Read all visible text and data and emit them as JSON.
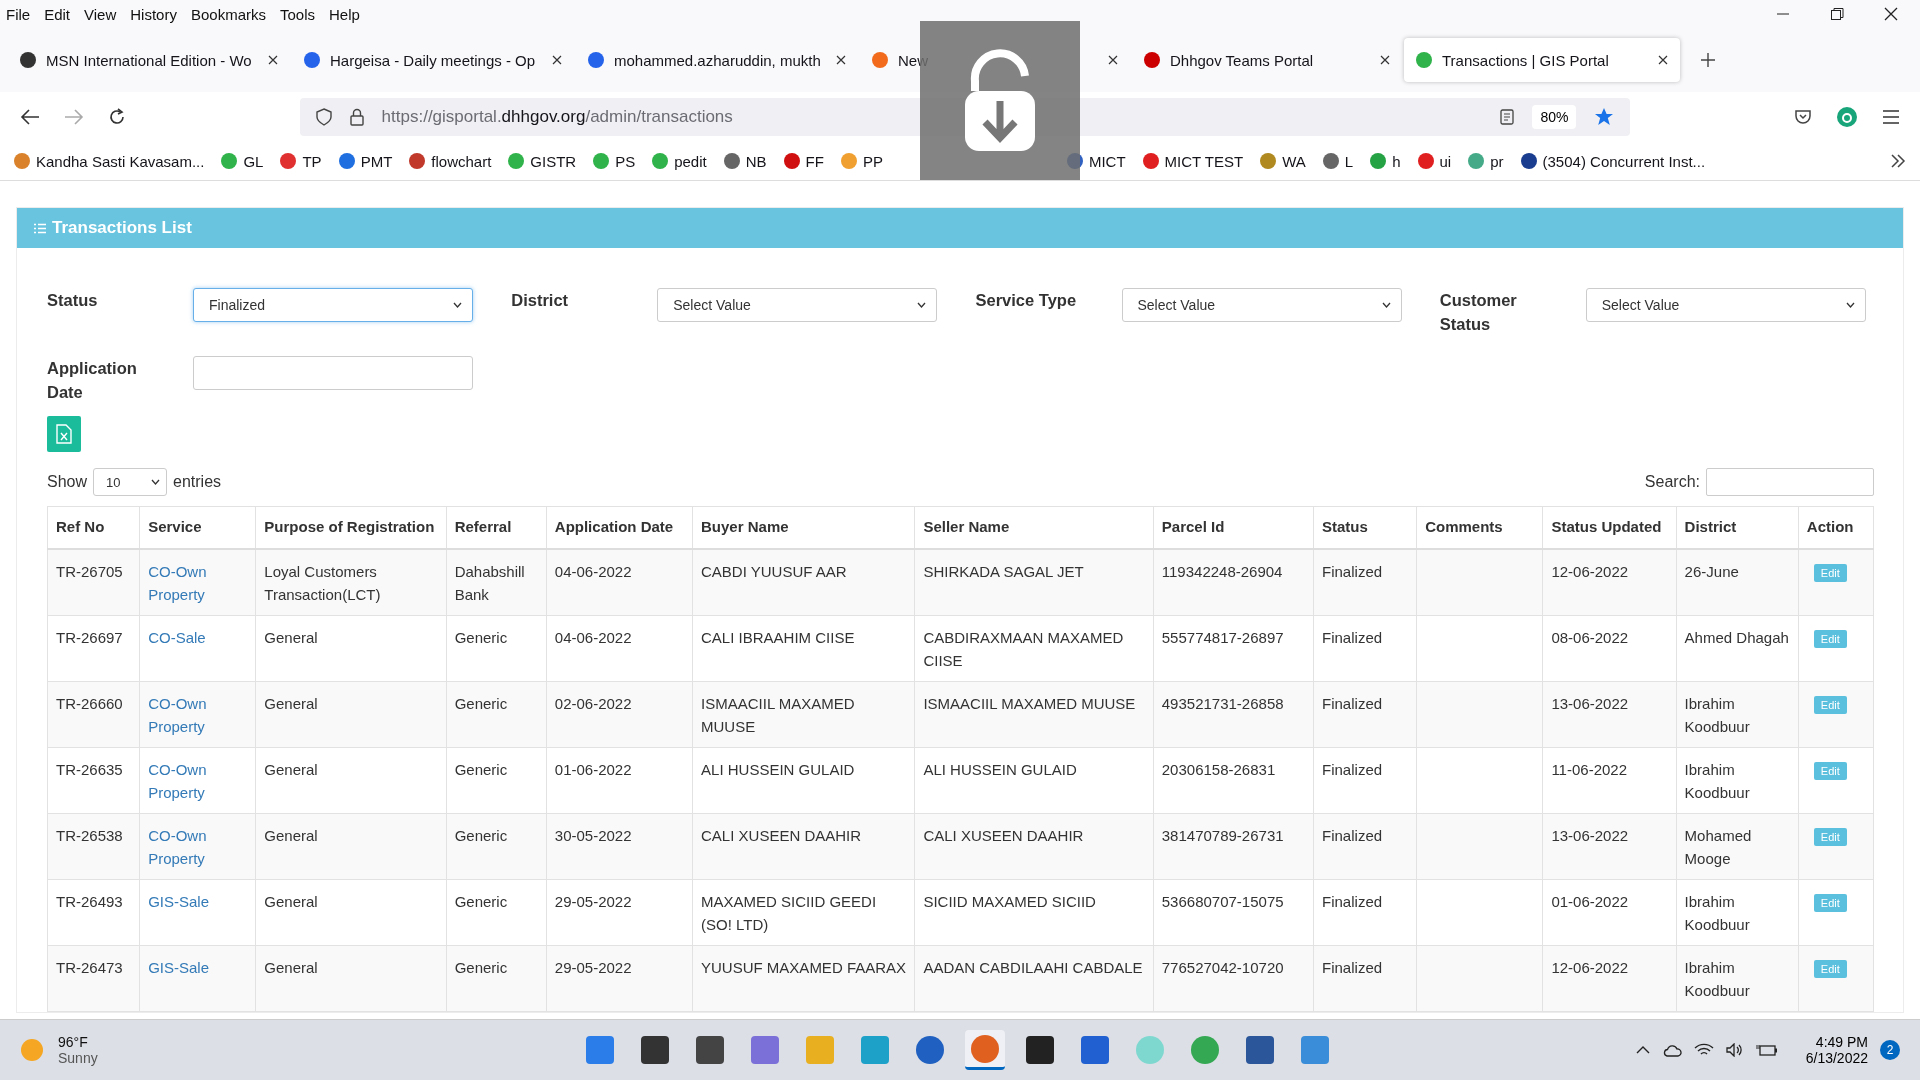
{
  "menu": [
    "File",
    "Edit",
    "View",
    "History",
    "Bookmarks",
    "Tools",
    "Help"
  ],
  "tabs": [
    {
      "title": "MSN International Edition - Wo",
      "selected": false
    },
    {
      "title": "Hargeisa - Daily meetings - Op",
      "selected": false
    },
    {
      "title": "mohammed.azharuddin, mukth",
      "selected": false
    },
    {
      "title": "New",
      "selected": false
    },
    {
      "title": "Dhhgov Teams Portal",
      "selected": false
    },
    {
      "title": "Transactions | GIS Portal",
      "selected": true
    }
  ],
  "address": {
    "prefix": "https://gisportal.",
    "domain": "dhhgov.org",
    "path": "/admin/transactions",
    "zoom": "80%"
  },
  "bookmarks": [
    "Kandha Sasti Kavasam...",
    "GL",
    "TP",
    "PMT",
    "flowchart",
    "GISTR",
    "PS",
    "pedit",
    "NB",
    "FF",
    "PP",
    "MICT",
    "MICT TEST",
    "WA",
    "L",
    "h",
    "ui",
    "pr",
    "(3504) Concurrent Inst..."
  ],
  "panel": {
    "title": "Transactions List"
  },
  "filters": [
    {
      "label": "Status",
      "value": "Finalized",
      "focused": true,
      "kind": "select"
    },
    {
      "label": "District",
      "value": "Select Value",
      "focused": false,
      "kind": "select"
    },
    {
      "label": "Service Type",
      "value": "Select Value",
      "focused": false,
      "kind": "select"
    },
    {
      "label": "Customer Status",
      "value": "Select Value",
      "focused": false,
      "kind": "select"
    },
    {
      "label": "Application Date",
      "focused": false,
      "kind": "input"
    }
  ],
  "length": {
    "before": "Show",
    "value": "10",
    "after": "entries"
  },
  "search": {
    "label": "Search:"
  },
  "table": {
    "columns": [
      "Ref No",
      "Service",
      "Purpose of Registration",
      "Referral",
      "Application Date",
      "Buyer Name",
      "Seller Name",
      "Parcel Id",
      "Status",
      "Comments",
      "Status Updated",
      "District",
      "Action"
    ],
    "rows": [
      {
        "ref": "TR-26705",
        "service": "CO-Own Property",
        "purpose": "Loyal Customers Transaction(LCT)",
        "referral": "Dahabshill Bank",
        "date": "04-06-2022",
        "buyer": "CABDI YUUSUF AAR",
        "seller": "SHIRKADA SAGAL JET",
        "parcel": "119342248-26904",
        "status": "Finalized",
        "updated": "12-06-2022",
        "district": "26-June",
        "action": "Edit"
      },
      {
        "ref": "TR-26697",
        "service": "CO-Sale",
        "purpose": "General",
        "referral": "Generic",
        "date": "04-06-2022",
        "buyer": "CALI IBRAAHIM CIISE",
        "seller": "CABDIRAXMAAN MAXAMED CIISE",
        "parcel": "555774817-26897",
        "status": "Finalized",
        "updated": "08-06-2022",
        "district": "Ahmed Dhagah",
        "action": "Edit"
      },
      {
        "ref": "TR-26660",
        "service": "CO-Own Property",
        "purpose": "General",
        "referral": "Generic",
        "date": "02-06-2022",
        "buyer": "ISMAACIIL MAXAMED MUUSE",
        "seller": "ISMAACIIL MAXAMED MUUSE",
        "parcel": "493521731-26858",
        "status": "Finalized",
        "updated": "13-06-2022",
        "district": "Ibrahim Koodbuur",
        "action": "Edit"
      },
      {
        "ref": "TR-26635",
        "service": "CO-Own Property",
        "purpose": "General",
        "referral": "Generic",
        "date": "01-06-2022",
        "buyer": "ALI HUSSEIN GULAID",
        "seller": "ALI HUSSEIN GULAID",
        "parcel": "20306158-26831",
        "status": "Finalized",
        "updated": "11-06-2022",
        "district": "Ibrahim Koodbuur",
        "action": "Edit"
      },
      {
        "ref": "TR-26538",
        "service": "CO-Own Property",
        "purpose": "General",
        "referral": "Generic",
        "date": "30-05-2022",
        "buyer": "CALI XUSEEN DAAHIR",
        "seller": "CALI XUSEEN DAAHIR",
        "parcel": "381470789-26731",
        "status": "Finalized",
        "updated": "13-06-2022",
        "district": "Mohamed Mooge",
        "action": "Edit"
      },
      {
        "ref": "TR-26493",
        "service": "GIS-Sale",
        "purpose": "General",
        "referral": "Generic",
        "date": "29-05-2022",
        "buyer": "MAXAMED SICIID GEEDI (SO! LTD)",
        "seller": "SICIID MAXAMED SICIID",
        "parcel": "536680707-15075",
        "status": "Finalized",
        "updated": "01-06-2022",
        "district": "Ibrahim Koodbuur",
        "action": "Edit"
      },
      {
        "ref": "TR-26473",
        "service": "GIS-Sale",
        "purpose": "General",
        "referral": "Generic",
        "date": "29-05-2022",
        "buyer": "YUUSUF MAXAMED FAARAX",
        "seller": "AADAN CABDILAAHI CABDALE",
        "parcel": "776527042-10720",
        "status": "Finalized",
        "updated": "12-06-2022",
        "district": "Ibrahim Koodbuur",
        "action": "Edit"
      }
    ]
  },
  "taskbar": {
    "temperature": "96°F",
    "weather": "Sunny",
    "time": "4:49 PM",
    "date": "6/13/2022",
    "notifications": "2"
  }
}
